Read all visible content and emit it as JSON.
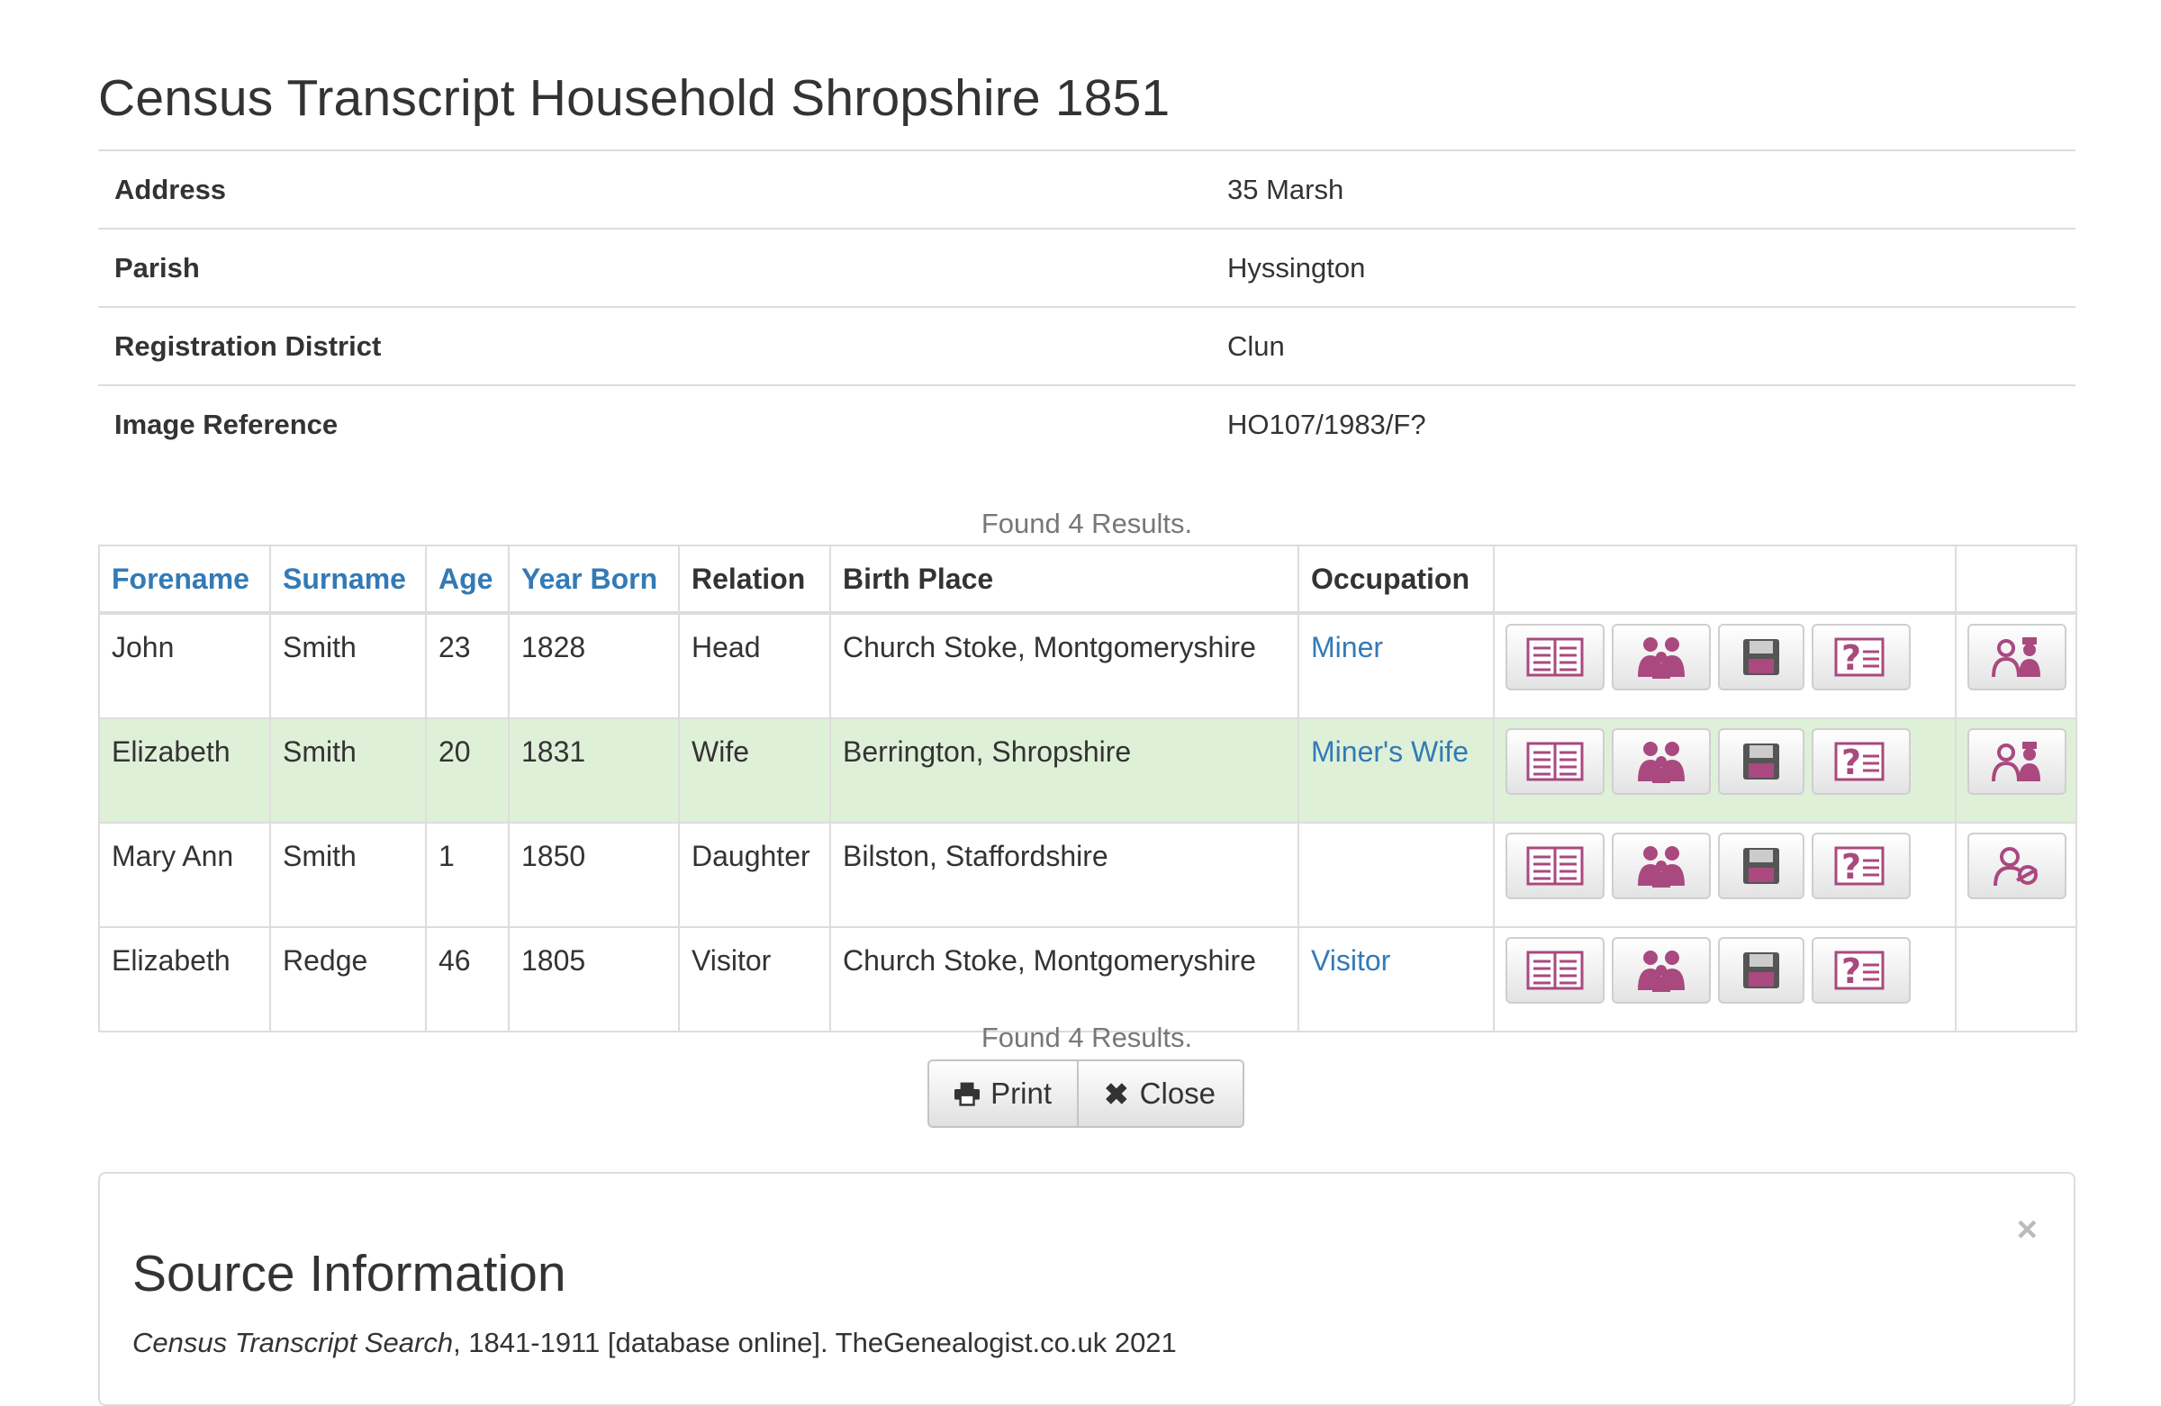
{
  "page": {
    "title": "Census Transcript Household Shropshire 1851"
  },
  "household": [
    {
      "label": "Address",
      "value": "35 Marsh"
    },
    {
      "label": "Parish",
      "value": "Hyssington"
    },
    {
      "label": "Registration District",
      "value": "Clun"
    },
    {
      "label": "Image Reference",
      "value": "HO107/1983/F?"
    }
  ],
  "results": {
    "found_text": "Found 4 Results.",
    "columns": {
      "forename": "Forename",
      "surname": "Surname",
      "age": "Age",
      "year_born": "Year Born",
      "relation": "Relation",
      "birth_place": "Birth Place",
      "occupation": "Occupation"
    },
    "rows": [
      {
        "forename": "John",
        "surname": "Smith",
        "age": "23",
        "year_born": "1828",
        "relation": "Head",
        "birth_place": "Church Stoke, Montgomeryshire",
        "occupation": "Miner",
        "extra_icon": "couple-icon"
      },
      {
        "forename": "Elizabeth",
        "surname": "Smith",
        "age": "20",
        "year_born": "1831",
        "relation": "Wife",
        "birth_place": "Berrington, Shropshire",
        "occupation": "Miner's Wife",
        "extra_icon": "couple-icon",
        "highlighted": true
      },
      {
        "forename": "Mary Ann",
        "surname": "Smith",
        "age": "1",
        "year_born": "1850",
        "relation": "Daughter",
        "birth_place": "Bilston, Staffordshire",
        "occupation": "",
        "extra_icon": "child-link-icon"
      },
      {
        "forename": "Elizabeth",
        "surname": "Redge",
        "age": "46",
        "year_born": "1805",
        "relation": "Visitor",
        "birth_place": "Church Stoke, Montgomeryshire",
        "occupation": "Visitor",
        "extra_icon": ""
      }
    ],
    "row_action_icons": [
      "transcript-icon",
      "household-icon",
      "save-icon",
      "query-icon"
    ]
  },
  "buttons": {
    "print": "Print",
    "close": "Close"
  },
  "source_panel": {
    "title": "Source Information",
    "source_italic": "Census Transcript Search",
    "source_rest": ", 1841-1911 [database online]. TheGenealogist.co.uk 2021",
    "dismiss": "×"
  },
  "colors": {
    "link": "#337ab7",
    "highlight_row": "#dff0d8",
    "icon": "#a9497f",
    "border": "#dddddd"
  }
}
